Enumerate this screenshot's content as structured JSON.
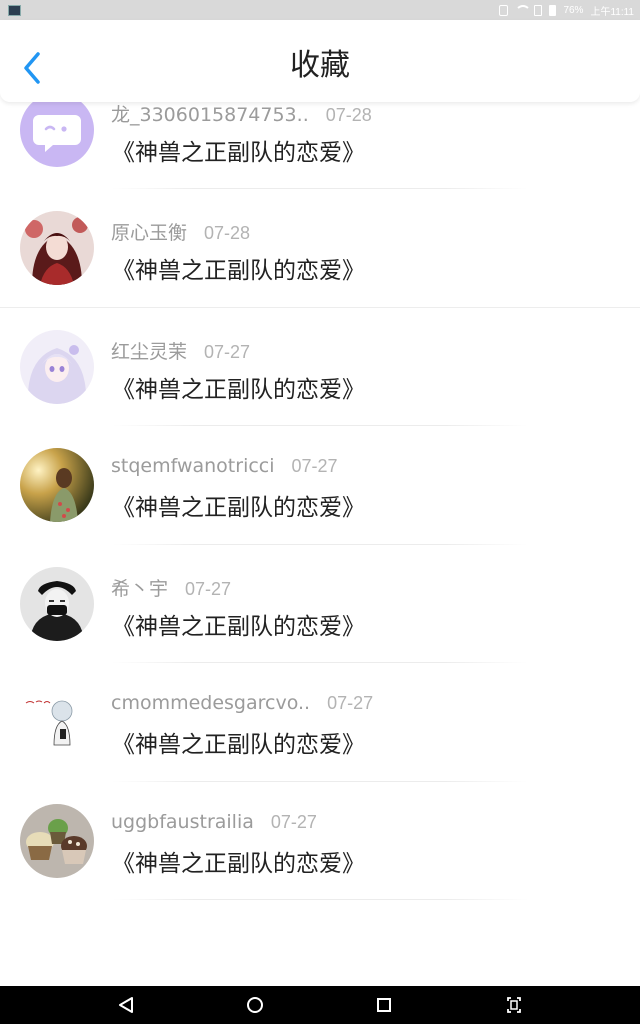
{
  "status_bar": {
    "battery": "76%",
    "time": "上午11:11"
  },
  "header": {
    "title": "收藏",
    "back_icon": "chevron-left-icon"
  },
  "items": [
    {
      "username": "",
      "date": "",
      "title": "《神兽之正副队的恋爱》",
      "avatar": "purple-chat-bubble"
    },
    {
      "username": "龙_3306015874753..",
      "date": "07-28",
      "title": "《神兽之正副队的恋爱》",
      "avatar": "purple-chat-bubble"
    },
    {
      "username": "原心玉衡",
      "date": "07-28",
      "title": "《神兽之正副队的恋爱》",
      "avatar": "anime-girl-red"
    },
    {
      "username": "红尘灵茉",
      "date": "07-27",
      "title": "《神兽之正副队的恋爱》",
      "avatar": "anime-girl-white"
    },
    {
      "username": "stqemfwanotricci",
      "date": "07-27",
      "title": "《神兽之正副队的恋爱》",
      "avatar": "girl-sunset-photo"
    },
    {
      "username": "希丶宇",
      "date": "07-27",
      "title": "《神兽之正副队的恋爱》",
      "avatar": "masked-boy-bw"
    },
    {
      "username": "cmommedesgarcvo..",
      "date": "07-27",
      "title": "《神兽之正副队的恋爱》",
      "avatar": "chibi-boy-sketch"
    },
    {
      "username": "uggbfaustrailia",
      "date": "07-27",
      "title": "《神兽之正副队的恋爱》",
      "avatar": "cupcakes-photo"
    }
  ],
  "nav_bar": {
    "back": "back-triangle-icon",
    "home": "home-circle-icon",
    "recents": "recents-square-icon",
    "screenshot": "screenshot-icon"
  },
  "colors": {
    "accent": "#2196f3",
    "avatar_purple": "#c9b7f3",
    "username": "#9b9b9b",
    "date": "#b3b3b3"
  }
}
